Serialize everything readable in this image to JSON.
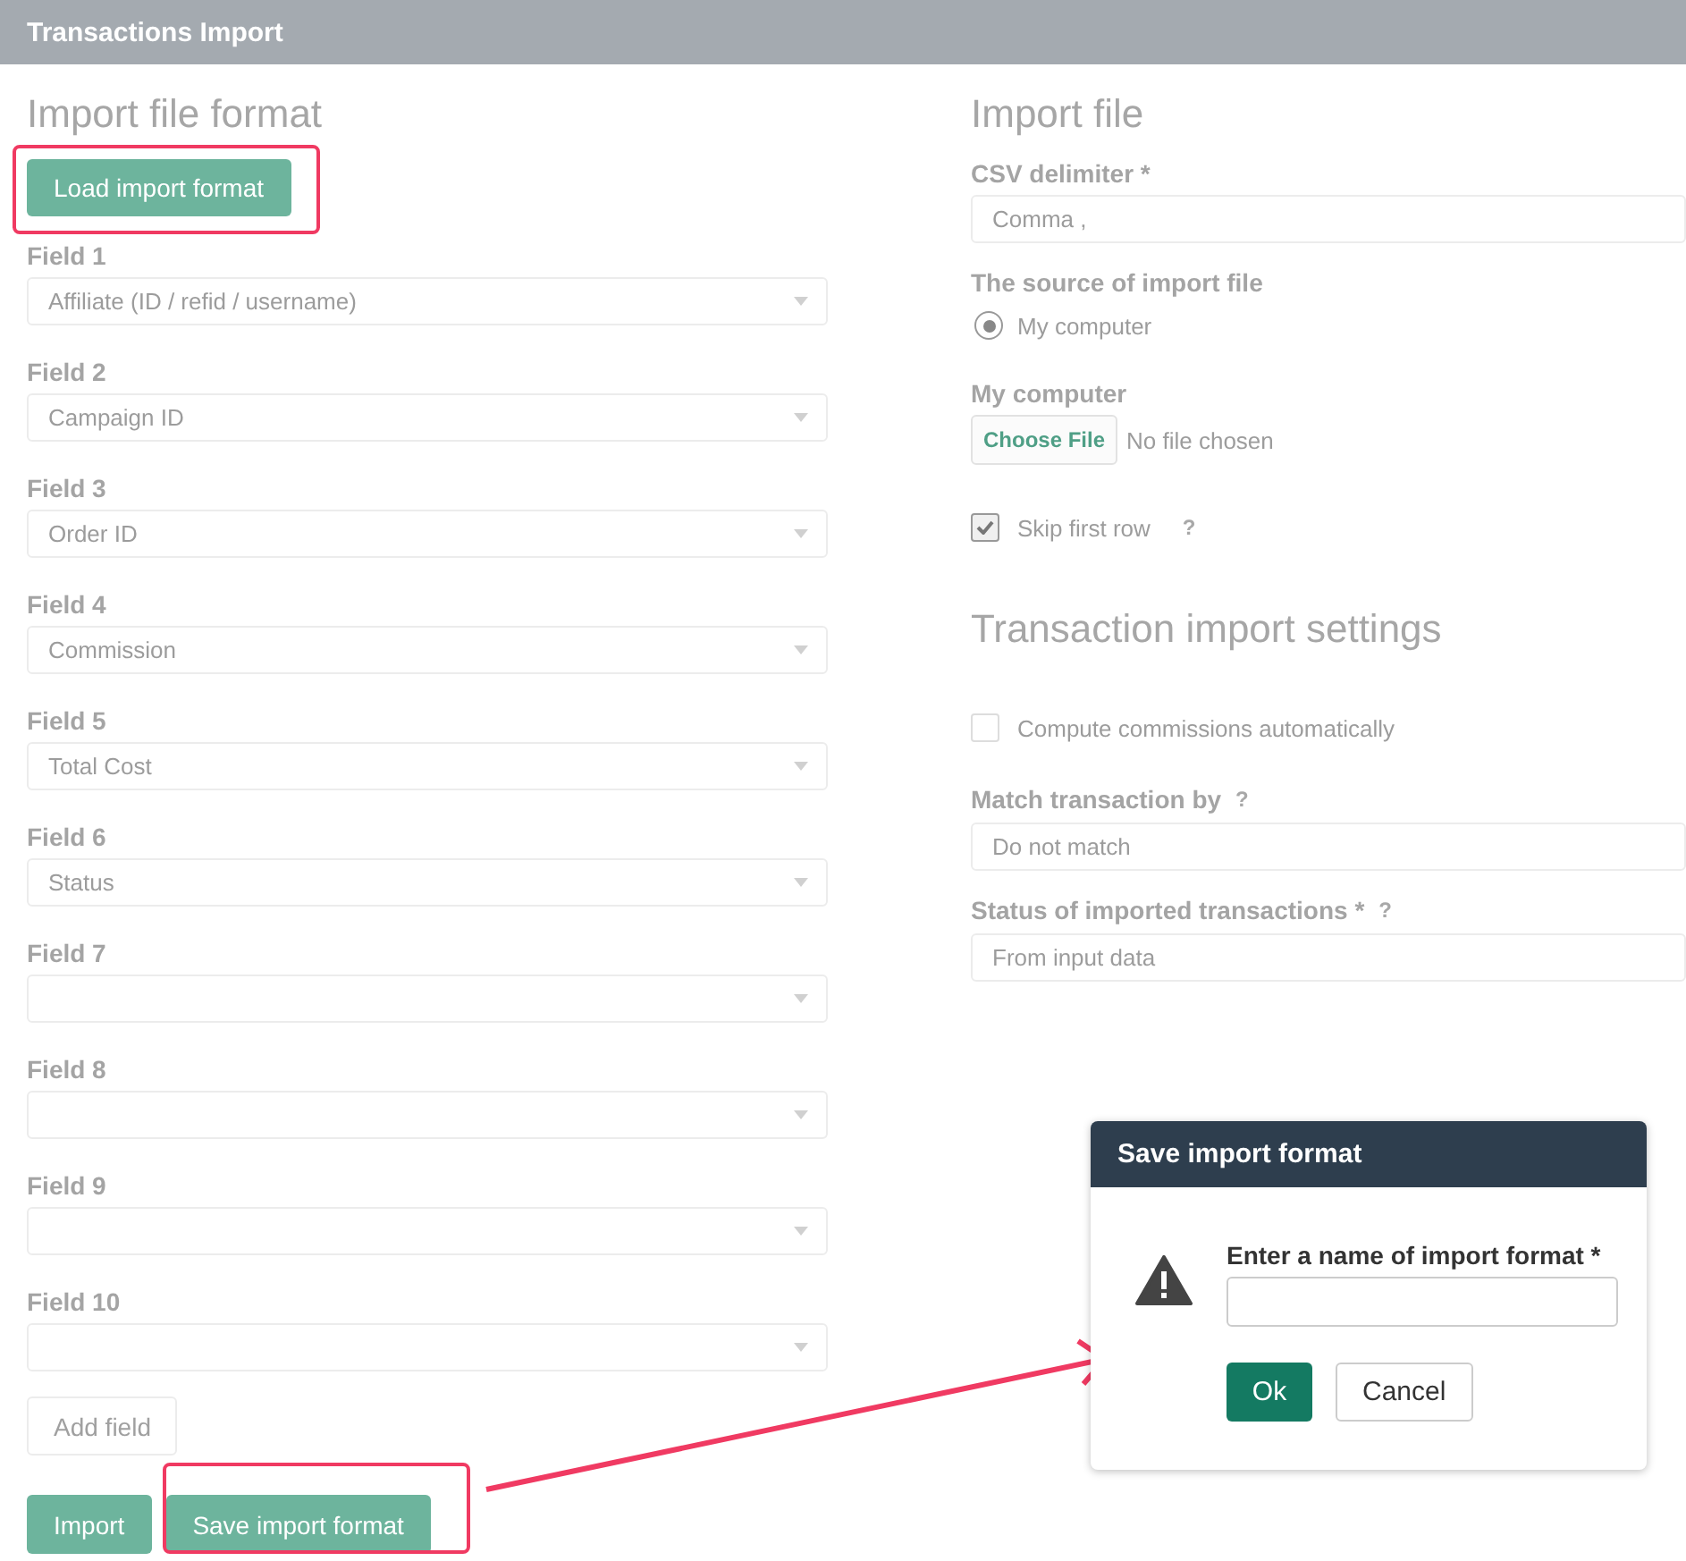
{
  "window": {
    "title": "Transactions Import"
  },
  "import_format": {
    "heading": "Import file format",
    "load_button": "Load import format",
    "fields": [
      {
        "label": "Field 1",
        "value": "Affiliate (ID / refid / username)"
      },
      {
        "label": "Field 2",
        "value": "Campaign ID"
      },
      {
        "label": "Field 3",
        "value": "Order ID"
      },
      {
        "label": "Field 4",
        "value": "Commission"
      },
      {
        "label": "Field 5",
        "value": "Total Cost"
      },
      {
        "label": "Field 6",
        "value": "Status"
      },
      {
        "label": "Field 7"
      },
      {
        "label": "Field 8"
      },
      {
        "label": "Field 9"
      },
      {
        "label": "Field 10"
      }
    ],
    "add_field_button": "Add field",
    "import_button": "Import",
    "save_format_button": "Save import format"
  },
  "import_file": {
    "heading": "Import file",
    "csv_delimiter": {
      "label": "CSV delimiter *",
      "value": "Comma ,"
    },
    "source": {
      "label": "The source of import file",
      "options": [
        {
          "label": "My computer",
          "selected": true
        }
      ]
    },
    "file": {
      "label": "My computer",
      "button": "Choose File",
      "status": "No file chosen"
    },
    "skip_first_row": {
      "label": "Skip first row",
      "checked": true,
      "help": "?"
    }
  },
  "settings": {
    "heading": "Transaction import settings",
    "compute_commissions": {
      "label": "Compute commissions automatically",
      "checked": false
    },
    "match_by": {
      "label": "Match transaction by",
      "help": "?",
      "value": "Do not match"
    },
    "status": {
      "label": "Status of imported transactions *",
      "help": "?",
      "value": "From input data"
    }
  },
  "dialog": {
    "title": "Save import format",
    "prompt": "Enter a name of import format *",
    "ok": "Ok",
    "cancel": "Cancel"
  }
}
